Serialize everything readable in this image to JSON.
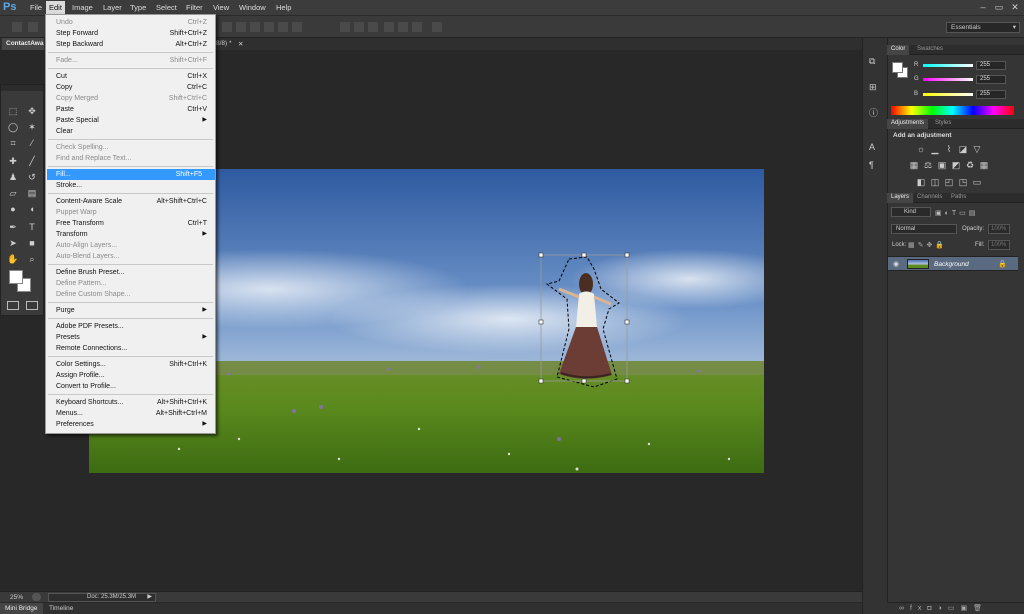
{
  "app": {
    "logo": "Ps"
  },
  "menubar": [
    "File",
    "Edit",
    "Image",
    "Layer",
    "Type",
    "Select",
    "Filter",
    "View",
    "Window",
    "Help"
  ],
  "window_controls": [
    "–",
    "▭",
    "✕"
  ],
  "workspace": {
    "label": "Essentials",
    "arrow": "▾"
  },
  "document": {
    "tab_title": "ContactAwa",
    "tab2_suffix": "8/8) *",
    "close": "✕"
  },
  "status": {
    "zoom": "25%",
    "doc": "Doc: 25.3M/25.3M",
    "arrow": "▶"
  },
  "bottom_tabs": [
    "Mini Bridge",
    "Timeline"
  ],
  "edit_menu": [
    {
      "label": "Undo",
      "key": "Ctrl+Z",
      "disabled": true
    },
    {
      "label": "Step Forward",
      "key": "Shift+Ctrl+Z"
    },
    {
      "label": "Step Backward",
      "key": "Alt+Ctrl+Z"
    },
    {
      "sep": true
    },
    {
      "label": "Fade...",
      "key": "Shift+Ctrl+F",
      "disabled": true
    },
    {
      "sep": true
    },
    {
      "label": "Cut",
      "key": "Ctrl+X"
    },
    {
      "label": "Copy",
      "key": "Ctrl+C"
    },
    {
      "label": "Copy Merged",
      "key": "Shift+Ctrl+C",
      "disabled": true
    },
    {
      "label": "Paste",
      "key": "Ctrl+V"
    },
    {
      "label": "Paste Special",
      "key": "",
      "submenu": true
    },
    {
      "label": "Clear",
      "key": ""
    },
    {
      "sep": true
    },
    {
      "label": "Check Spelling...",
      "key": "",
      "disabled": true
    },
    {
      "label": "Find and Replace Text...",
      "key": "",
      "disabled": true
    },
    {
      "sep": true
    },
    {
      "label": "Fill...",
      "key": "Shift+F5",
      "highlight": true
    },
    {
      "label": "Stroke...",
      "key": ""
    },
    {
      "sep": true
    },
    {
      "label": "Content-Aware Scale",
      "key": "Alt+Shift+Ctrl+C"
    },
    {
      "label": "Puppet Warp",
      "key": "",
      "disabled": true
    },
    {
      "label": "Free Transform",
      "key": "Ctrl+T"
    },
    {
      "label": "Transform",
      "key": "",
      "submenu": true
    },
    {
      "label": "Auto-Align Layers...",
      "key": "",
      "disabled": true
    },
    {
      "label": "Auto-Blend Layers...",
      "key": "",
      "disabled": true
    },
    {
      "sep": true
    },
    {
      "label": "Define Brush Preset...",
      "key": ""
    },
    {
      "label": "Define Pattern...",
      "key": "",
      "disabled": true
    },
    {
      "label": "Define Custom Shape...",
      "key": "",
      "disabled": true
    },
    {
      "sep": true
    },
    {
      "label": "Purge",
      "key": "",
      "submenu": true
    },
    {
      "sep": true
    },
    {
      "label": "Adobe PDF Presets...",
      "key": ""
    },
    {
      "label": "Presets",
      "key": "",
      "submenu": true
    },
    {
      "label": "Remote Connections...",
      "key": ""
    },
    {
      "sep": true
    },
    {
      "label": "Color Settings...",
      "key": "Shift+Ctrl+K"
    },
    {
      "label": "Assign Profile...",
      "key": ""
    },
    {
      "label": "Convert to Profile...",
      "key": ""
    },
    {
      "sep": true
    },
    {
      "label": "Keyboard Shortcuts...",
      "key": "Alt+Shift+Ctrl+K"
    },
    {
      "label": "Menus...",
      "key": "Alt+Shift+Ctrl+M"
    },
    {
      "label": "Preferences",
      "key": "",
      "submenu": true
    }
  ],
  "color_panel": {
    "tabs": [
      "Color",
      "Swatches"
    ],
    "channels": [
      {
        "name": "R",
        "value": "255",
        "color": "#ff0000"
      },
      {
        "name": "G",
        "value": "255",
        "color": "#00ff00"
      },
      {
        "name": "B",
        "value": "255",
        "color": "#0000ff"
      }
    ]
  },
  "adjustments_panel": {
    "tabs": [
      "Adjustments",
      "Styles"
    ],
    "heading": "Add an adjustment"
  },
  "layers_panel": {
    "tabs": [
      "Layers",
      "Channels",
      "Paths"
    ],
    "kind": "Kind",
    "blend": "Normal",
    "opacity_label": "Opacity:",
    "opacity": "100%",
    "lock_label": "Lock:",
    "fill_label": "Fill:",
    "fill": "100%",
    "layer_name": "Background"
  },
  "colors": {
    "accent": "#3399ff",
    "panel": "#353535",
    "canvas_bg": "#282828"
  }
}
